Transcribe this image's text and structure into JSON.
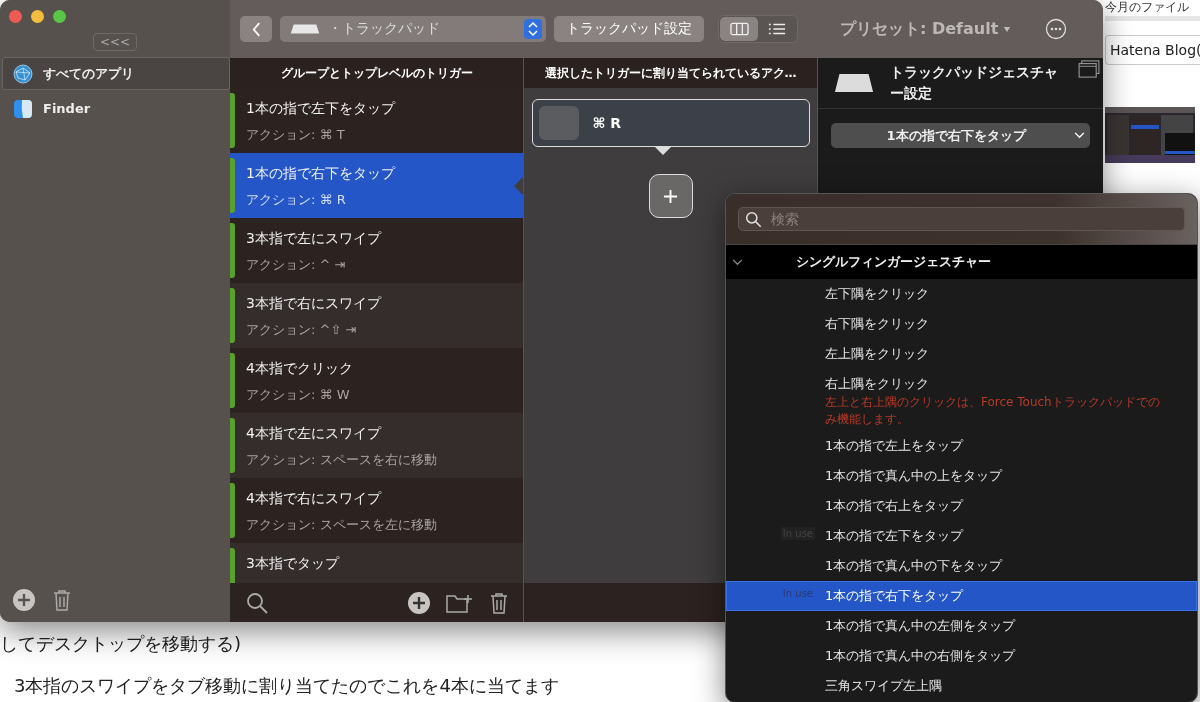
{
  "background_page": {
    "header_text": "今月のファイル",
    "blog_field": "Hatena Blog(",
    "paragraphs": [
      "してデスクトップを移動する)",
      "3本指のスワイプをタブ移動に割り当てたのでこれを4本に当てます"
    ]
  },
  "window": {
    "collapse_button": "<<<",
    "sidebar": {
      "items": [
        {
          "label": "すべてのアプリ",
          "selected": true
        },
        {
          "label": "Finder",
          "selected": false
        }
      ]
    },
    "toolbar": {
      "device": "・トラックパッド",
      "settings_button": "トラックパッド設定",
      "view_modes": [
        {
          "selected": true
        },
        {
          "selected": false
        }
      ],
      "preset": "プリセット: Default"
    },
    "triggers": {
      "heading": "グループとトップレベルのトリガー",
      "items": [
        {
          "title": "1本の指で左下をタップ",
          "action": "アクション: ⌘ T",
          "selected": false
        },
        {
          "title": "1本の指で右下をタップ",
          "action": "アクション: ⌘ R",
          "selected": true
        },
        {
          "title": "3本指で左にスワイプ",
          "action": "アクション: ^ ⇥",
          "selected": false
        },
        {
          "title": "3本指で右にスワイプ",
          "action": "アクション: ^⇧ ⇥",
          "selected": false
        },
        {
          "title": "4本指でクリック",
          "action": "アクション: ⌘ W",
          "selected": false
        },
        {
          "title": "4本指で左にスワイプ",
          "action": "アクション: スペースを右に移動",
          "selected": false
        },
        {
          "title": "4本指で右にスワイプ",
          "action": "アクション: スペースを左に移動",
          "selected": false
        },
        {
          "title": "3本指でタップ",
          "selected": false
        }
      ]
    },
    "actions": {
      "heading": "選択したトリガーに割り当てられているアク…",
      "items": [
        {
          "shortcut": "⌘ R"
        }
      ]
    },
    "settings": {
      "title": "トラックパッドジェスチャー設定",
      "gesture": "1本の指で右下をタップ"
    }
  },
  "popup": {
    "search_placeholder": "検索",
    "group": {
      "label": "シングルフィンガージェスチャー",
      "expanded": true
    },
    "items": [
      {
        "label": "左下隅をクリック",
        "selected": false
      },
      {
        "label": "右下隅をクリック",
        "selected": false
      },
      {
        "label": "左上隅をクリック",
        "selected": false
      },
      {
        "label": "右上隅をクリック",
        "note": "左上と右上隅のクリックは、Force Touchトラックパッドでのみ機能します。",
        "selected": false
      },
      {
        "label": "1本の指で左上をタップ",
        "selected": false
      },
      {
        "label": "1本の指で真ん中の上をタップ",
        "selected": false
      },
      {
        "label": "1本の指で右上をタップ",
        "selected": false
      },
      {
        "label": "1本の指で左下をタップ",
        "badge": "In use",
        "selected": false
      },
      {
        "label": "1本の指で真ん中の下をタップ",
        "selected": false
      },
      {
        "label": "1本の指で右下をタップ",
        "badge": "In use",
        "selected": true
      },
      {
        "label": "1本の指で真ん中の左側をタップ",
        "selected": false
      },
      {
        "label": "1本の指で真ん中の右側をタップ",
        "selected": false
      },
      {
        "label": "三角スワイプ左上隅",
        "selected": false
      }
    ]
  }
}
